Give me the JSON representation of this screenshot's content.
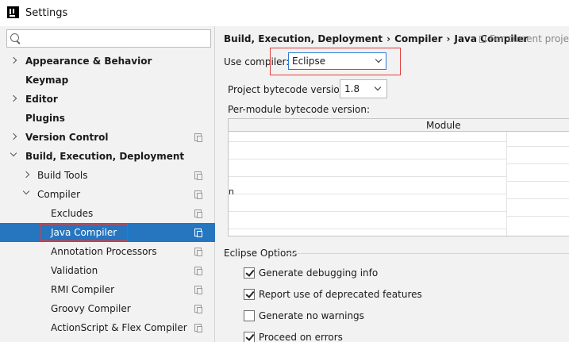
{
  "window": {
    "title": "Settings"
  },
  "search": {
    "placeholder": ""
  },
  "tree": {
    "items": [
      {
        "label": "Appearance & Behavior",
        "bold": true,
        "arrow": "collapsed",
        "indent": 0,
        "page_icon": false
      },
      {
        "label": "Keymap",
        "bold": true,
        "arrow": "none",
        "indent": 0,
        "page_icon": false
      },
      {
        "label": "Editor",
        "bold": true,
        "arrow": "collapsed",
        "indent": 0,
        "page_icon": false
      },
      {
        "label": "Plugins",
        "bold": true,
        "arrow": "none",
        "indent": 0,
        "page_icon": false
      },
      {
        "label": "Version Control",
        "bold": true,
        "arrow": "collapsed",
        "indent": 0,
        "page_icon": true
      },
      {
        "label": "Build, Execution, Deployment",
        "bold": true,
        "arrow": "expanded",
        "indent": 0,
        "page_icon": false
      },
      {
        "label": "Build Tools",
        "bold": false,
        "arrow": "collapsed",
        "indent": 1,
        "page_icon": true
      },
      {
        "label": "Compiler",
        "bold": false,
        "arrow": "expanded",
        "indent": 1,
        "page_icon": true
      },
      {
        "label": "Excludes",
        "bold": false,
        "arrow": "none",
        "indent": 2,
        "page_icon": true
      },
      {
        "label": "Java Compiler",
        "bold": false,
        "arrow": "none",
        "indent": 2,
        "page_icon": true,
        "selected": true
      },
      {
        "label": "Annotation Processors",
        "bold": false,
        "arrow": "none",
        "indent": 2,
        "page_icon": true
      },
      {
        "label": "Validation",
        "bold": false,
        "arrow": "none",
        "indent": 2,
        "page_icon": true
      },
      {
        "label": "RMI Compiler",
        "bold": false,
        "arrow": "none",
        "indent": 2,
        "page_icon": true
      },
      {
        "label": "Groovy Compiler",
        "bold": false,
        "arrow": "none",
        "indent": 2,
        "page_icon": true
      },
      {
        "label": "ActionScript & Flex Compiler",
        "bold": false,
        "arrow": "none",
        "indent": 2,
        "page_icon": true
      }
    ]
  },
  "breadcrumb": {
    "part1": "Build, Execution, Deployment",
    "sep1": "›",
    "part2": "Compiler",
    "sep2": "›",
    "part3": "Java Compiler",
    "scope": "For current project"
  },
  "compiler": {
    "use_label": "Use compiler:",
    "selected": "Eclipse",
    "bytecode_label": "Project bytecode version:",
    "bytecode_value": "1.8",
    "permodule_label": "Per-module bytecode version:",
    "table_header": "Module",
    "row_fragment": "n"
  },
  "eclipse_options": {
    "title": "Eclipse Options",
    "items": [
      {
        "label": "Generate debugging info",
        "checked": true
      },
      {
        "label": "Report use of deprecated features",
        "checked": true
      },
      {
        "label": "Generate no warnings",
        "checked": false
      },
      {
        "label": "Proceed on errors",
        "checked": true
      }
    ]
  },
  "colors": {
    "selection": "#2675bf",
    "highlight_border": "#e03c3c",
    "focus_border": "#2c7ad6"
  }
}
